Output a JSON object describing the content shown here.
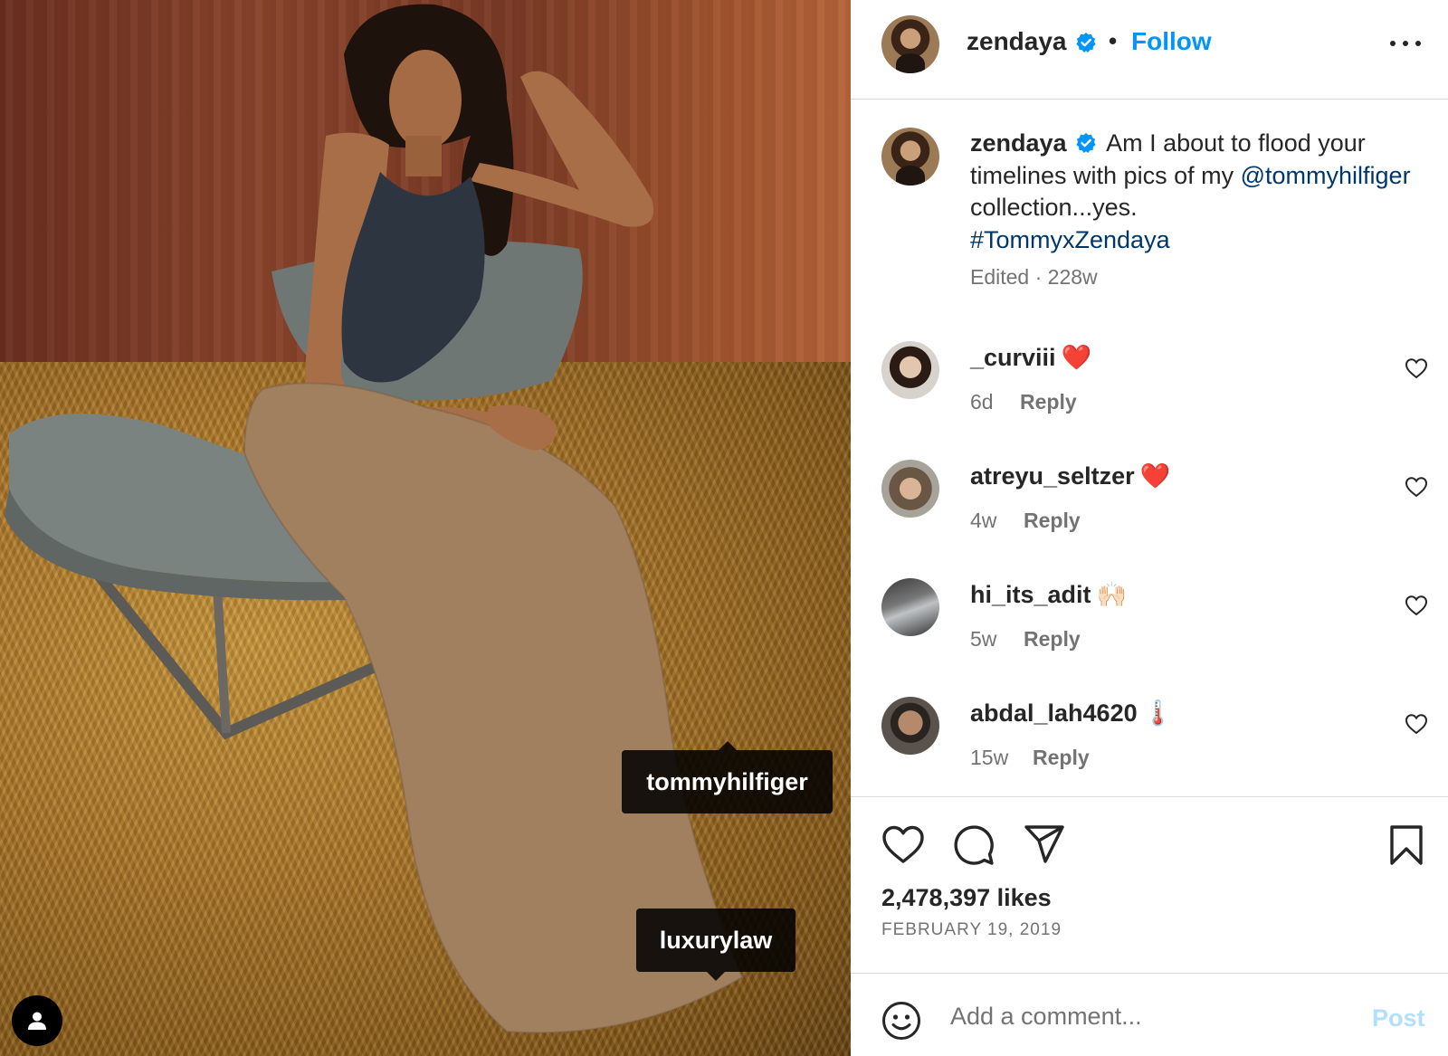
{
  "photo": {
    "tags": [
      "tommyhilfiger",
      "luxurylaw"
    ],
    "user_tag_icon": "person-icon"
  },
  "header": {
    "username": "zendaya",
    "verified_icon": "verified-badge-icon",
    "separator": "•",
    "follow_label": "Follow",
    "more_icon": "more-options-icon"
  },
  "caption": {
    "username": "zendaya",
    "text_before_mention": "Am I about to flood your timelines with pics of my",
    "mention": "@tommyhilfiger",
    "text_after_mention": "collection...yes.",
    "hashtag": "#TommyxZendaya",
    "meta": "Edited · 228w"
  },
  "comments": [
    {
      "username": "_curviii",
      "emoji": "❤️",
      "time": "6d",
      "reply_label": "Reply"
    },
    {
      "username": "atreyu_seltzer",
      "emoji": "❤️",
      "time": "4w",
      "reply_label": "Reply"
    },
    {
      "username": "hi_its_adit",
      "emoji": "🙌🏻",
      "time": "5w",
      "reply_label": "Reply"
    },
    {
      "username": "abdal_lah4620",
      "emoji": "🌡️",
      "time": "15w",
      "reply_label": "Reply"
    }
  ],
  "actions": {
    "icons": [
      "heart-icon",
      "comment-icon",
      "share-icon",
      "bookmark-icon"
    ],
    "likes": "2,478,397 likes",
    "date": "FEBRUARY 19, 2019"
  },
  "comment_bar": {
    "emoji_icon": "smiley-icon",
    "placeholder": "Add a comment...",
    "post_label": "Post"
  },
  "colors": {
    "link_blue": "#0095f6",
    "mention_blue": "#00376b",
    "muted": "#737373",
    "post_disabled": "#b2dffc",
    "text": "#262626"
  }
}
